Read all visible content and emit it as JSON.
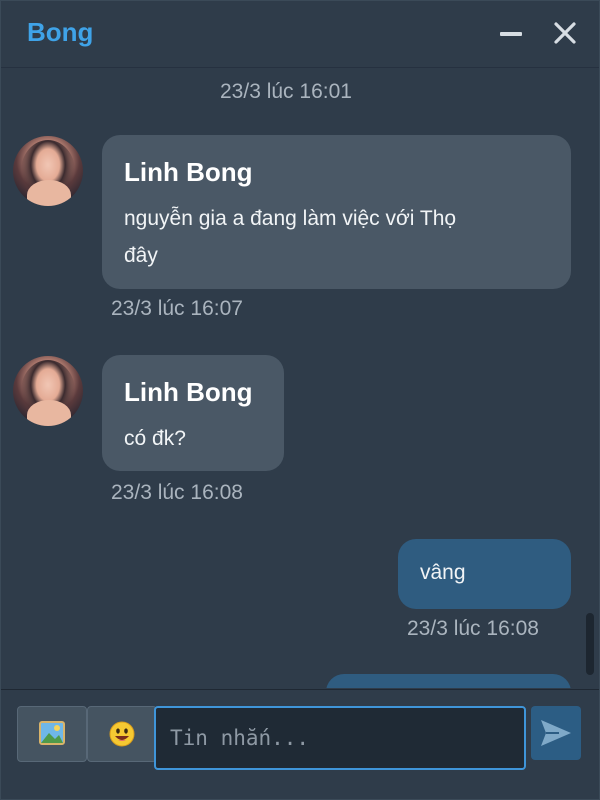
{
  "header": {
    "title": "Bong",
    "minimize_icon": "minus-icon",
    "close_icon": "close-icon"
  },
  "messages": [
    {
      "type": "timestamp",
      "text": "23/3 lúc 16:01"
    },
    {
      "type": "incoming",
      "sender": "Linh Bong",
      "lines": [
        "nguyễn gia a đang làm việc với Thọ",
        "đây"
      ],
      "time": "23/3 lúc 16:07"
    },
    {
      "type": "incoming",
      "sender": "Linh Bong",
      "lines": [
        "có đk?"
      ],
      "time": "23/3 lúc 16:08"
    },
    {
      "type": "outgoing",
      "text": "vâng",
      "time": "23/3 lúc 16:08"
    }
  ],
  "composer": {
    "image_button_icon": "image-icon",
    "emoji_button_icon": "smiley-emoji-icon",
    "input_placeholder": "Tin nhắn...",
    "input_value": "",
    "send_icon": "send-arrow-icon"
  },
  "colors": {
    "title": "#3fa3e8",
    "incoming_bubble": "#4a5866",
    "outgoing_bubble": "#2f5c80",
    "input_border": "#3f95d9"
  }
}
